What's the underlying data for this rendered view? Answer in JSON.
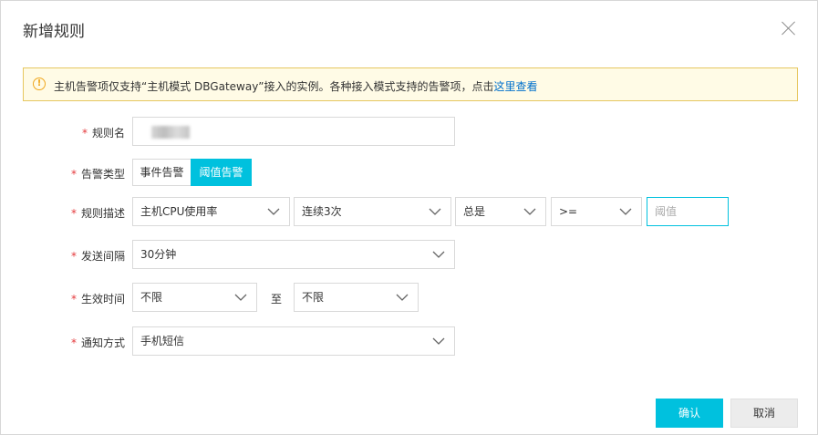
{
  "dialog": {
    "title": "新增规则",
    "close_icon": "close-icon"
  },
  "notice": {
    "icon": "warning-icon",
    "icon_glyph": "!",
    "text": "主机告警项仅支持“主机模式 DBGateway”接入的实例。各种接入模式支持的告警项，点击",
    "link": "这里查看"
  },
  "form": {
    "required_mark": "*",
    "rule_name": {
      "label": "规则名",
      "value": ""
    },
    "alarm_type": {
      "label": "告警类型",
      "options": [
        "事件告警",
        "阈值告警"
      ],
      "selected": "阈值告警"
    },
    "rule_desc": {
      "label": "规则描述",
      "metric": "主机CPU使用率",
      "times": "连续3次",
      "mode": "总是",
      "operator": ">=",
      "threshold_placeholder": "阈值"
    },
    "send_interval": {
      "label": "发送间隔",
      "value": "30分钟"
    },
    "effective_time": {
      "label": "生效时间",
      "from": "不限",
      "to_label": "至",
      "to": "不限"
    },
    "notify": {
      "label": "通知方式",
      "value": "手机短信"
    }
  },
  "footer": {
    "confirm": "确认",
    "cancel": "取消"
  },
  "colors": {
    "accent": "#00c1de",
    "required": "#e4393c",
    "link": "#0070cc",
    "notice_bg": "#fffbe6",
    "notice_border": "#e6c760"
  }
}
